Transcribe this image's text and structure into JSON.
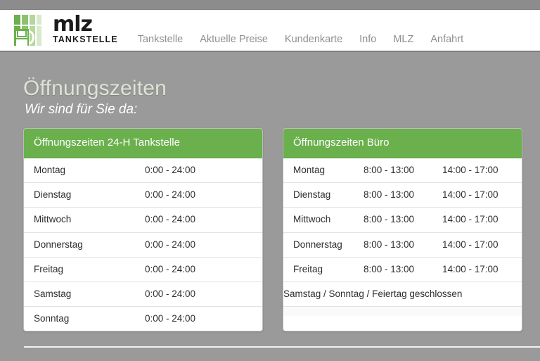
{
  "brand": {
    "logo_word": "mlz",
    "logo_sub": "TANKSTELLE",
    "logo_icon": "fuel-pump-bars-logo",
    "green": "#6ab04c"
  },
  "nav": {
    "items": [
      {
        "label": "Tankstelle"
      },
      {
        "label": "Aktuelle Preise"
      },
      {
        "label": "Kundenkarte"
      },
      {
        "label": "Info"
      },
      {
        "label": "MLZ"
      },
      {
        "label": "Anfahrt"
      }
    ]
  },
  "page": {
    "title": "Öffnungszeiten",
    "subtitle": "Wir sind für Sie da:"
  },
  "panels": [
    {
      "heading": "Öffnungszeiten 24-H Tankstelle",
      "rows": [
        {
          "day": "Montag",
          "time1": "0:00 - 24:00"
        },
        {
          "day": "Dienstag",
          "time1": "0:00 - 24:00"
        },
        {
          "day": "Mittwoch",
          "time1": "0:00 - 24:00"
        },
        {
          "day": "Donnerstag",
          "time1": "0:00 - 24:00"
        },
        {
          "day": "Freitag",
          "time1": "0:00 - 24:00"
        },
        {
          "day": "Samstag",
          "time1": "0:00 - 24:00"
        },
        {
          "day": "Sonntag",
          "time1": "0:00 - 24:00"
        }
      ]
    },
    {
      "heading": "Öffnungszeiten Büro",
      "rows": [
        {
          "day": "Montag",
          "time1": "8:00 - 13:00",
          "time2": "14:00 - 17:00"
        },
        {
          "day": "Dienstag",
          "time1": "8:00 - 13:00",
          "time2": "14:00 - 17:00"
        },
        {
          "day": "Mittwoch",
          "time1": "8:00 - 13:00",
          "time2": "14:00 - 17:00"
        },
        {
          "day": "Donnerstag",
          "time1": "8:00 - 13:00",
          "time2": "14:00 - 17:00"
        },
        {
          "day": "Freitag",
          "time1": "8:00 - 13:00",
          "time2": "14:00 - 17:00"
        }
      ],
      "closed_note": "Samstag / Sonntag / Feiertag geschlossen"
    }
  ]
}
